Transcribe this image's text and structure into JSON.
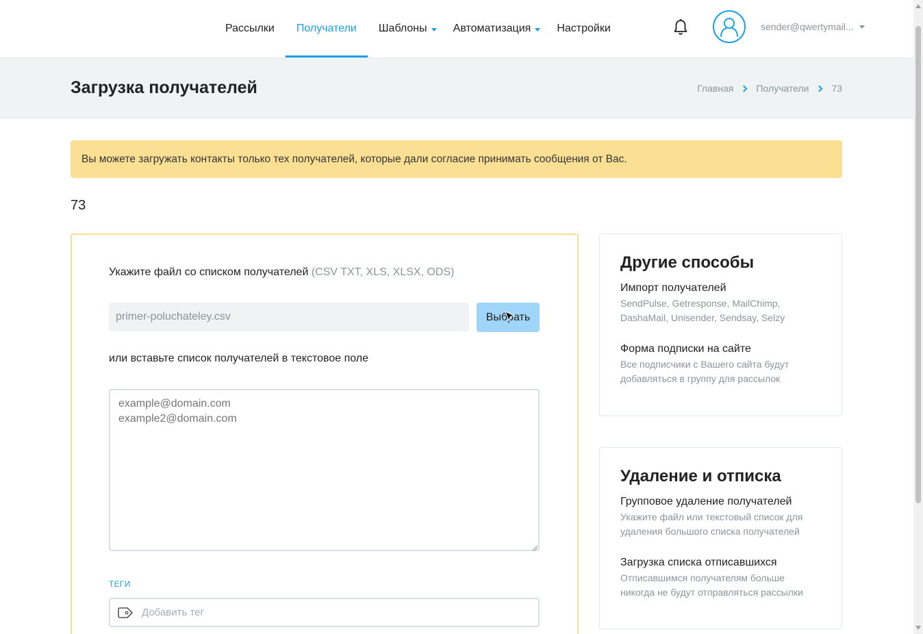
{
  "nav": {
    "items": [
      {
        "label": "Рассылки"
      },
      {
        "label": "Получатели"
      },
      {
        "label": "Шаблоны"
      },
      {
        "label": "Автоматизация"
      },
      {
        "label": "Настройки"
      }
    ],
    "user_email": "sender@qwertymail...",
    "active_tab": "Получатели",
    "accent_color": "#1aa0e6"
  },
  "header": {
    "title": "Загрузка получателей",
    "breadcrumbs": [
      "Главная",
      "Получатели",
      "73"
    ]
  },
  "notice": {
    "text": "Вы можете загружать контакты только тех получателей, которые дали согласие принимать сообщения от Вас.",
    "color": "#fbe094"
  },
  "group_number": "73",
  "upload": {
    "file_label": "Укажите файл со списком получателей",
    "file_hint": "(CSV TXT, XLS, XLSX, ODS)",
    "file_value": "primer-poluchateley.csv",
    "choose_button": "Выбрать",
    "or_label": "или вставьте список получателей в текстовое поле",
    "textarea_placeholder": "example@domain.com\nexample2@domain.com",
    "tags_label": "ТЕГИ",
    "tag_placeholder": "Добавить тег"
  },
  "side_other": {
    "title": "Другие способы",
    "items": [
      {
        "title": "Импорт получателей",
        "desc": "SendPulse, Getresponse, MailChimp, DashaMail, Unisender, Sendsay, Selzy"
      },
      {
        "title": "Форма подписки на сайте",
        "desc": "Все подписчики с Вашего сайта будут добавляться в группу для рассылок"
      }
    ]
  },
  "side_remove": {
    "title": "Удаление и отписка",
    "items": [
      {
        "title": "Групповое удаление получателей",
        "desc": "Укажите файл или текстовый список для удаления большого списка получателей"
      },
      {
        "title": "Загрузка списка отписавшихся",
        "desc": "Отписавшимся получателям больше никогда не будут отправляться рассылки"
      }
    ]
  }
}
